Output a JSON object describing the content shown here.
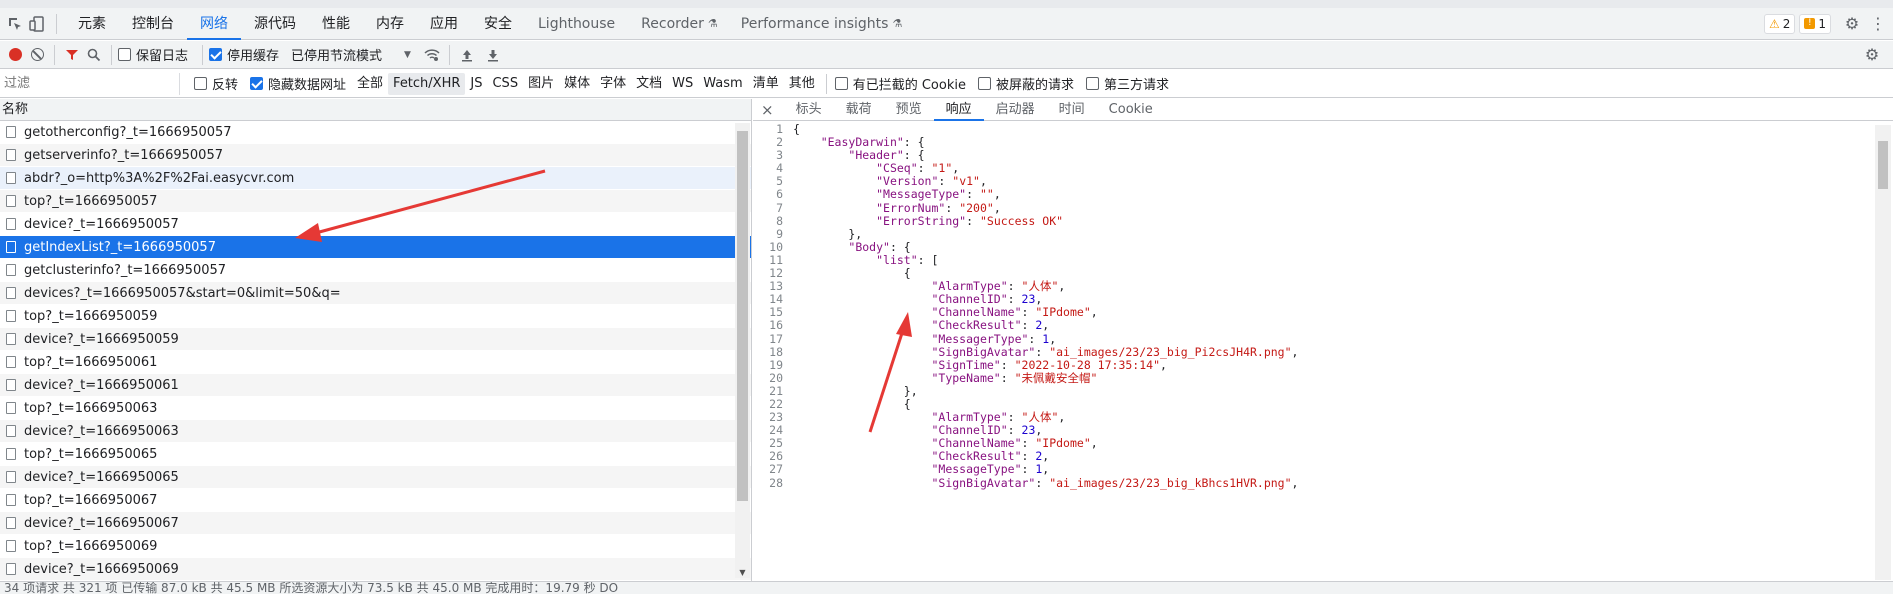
{
  "panel_tabs": [
    "元素",
    "控制台",
    "网络",
    "源代码",
    "性能",
    "内存",
    "应用",
    "安全",
    "Lighthouse",
    "Recorder",
    "Performance insights"
  ],
  "badges": {
    "warnings": "2",
    "issues": "1"
  },
  "toolbar": {
    "preserve_log": "保留日志",
    "disable_cache": "停用缓存",
    "throttle": "已停用节流模式",
    "throttle_caret": "▼"
  },
  "filter": {
    "placeholder": "过滤",
    "invert": "反转",
    "hide_data_urls": "隐藏数据网址",
    "types": [
      "全部",
      "Fetch/XHR",
      "JS",
      "CSS",
      "图片",
      "媒体",
      "字体",
      "文档",
      "WS",
      "Wasm",
      "清单",
      "其他"
    ],
    "blocked_cookies": "有已拦截的 Cookie",
    "blocked_requests": "被屏蔽的请求",
    "third_party": "第三方请求"
  },
  "list": {
    "header": "名称",
    "rows": [
      "getotherconfig?_t=1666950057",
      "getserverinfo?_t=1666950057",
      "abdr?_o=http%3A%2F%2Fai.easycvr.com",
      "top?_t=1666950057",
      "device?_t=1666950057",
      "getIndexList?_t=1666950057",
      "getclusterinfo?_t=1666950057",
      "devices?_t=1666950057&start=0&limit=50&q=",
      "top?_t=1666950059",
      "device?_t=1666950059",
      "top?_t=1666950061",
      "device?_t=1666950061",
      "top?_t=1666950063",
      "device?_t=1666950063",
      "top?_t=1666950065",
      "device?_t=1666950065",
      "top?_t=1666950067",
      "device?_t=1666950067",
      "top?_t=1666950069",
      "device?_t=1666950069"
    ]
  },
  "detail": {
    "close": "×",
    "tabs": [
      "标头",
      "载荷",
      "预览",
      "响应",
      "启动器",
      "时间",
      "Cookie"
    ]
  },
  "code_lines": [
    [
      {
        "t": "p",
        "v": "{"
      }
    ],
    [
      {
        "t": "p",
        "v": "    "
      },
      {
        "t": "k",
        "v": "\"EasyDarwin\""
      },
      {
        "t": "p",
        "v": ": {"
      }
    ],
    [
      {
        "t": "p",
        "v": "        "
      },
      {
        "t": "k",
        "v": "\"Header\""
      },
      {
        "t": "p",
        "v": ": {"
      }
    ],
    [
      {
        "t": "p",
        "v": "            "
      },
      {
        "t": "k",
        "v": "\"CSeq\""
      },
      {
        "t": "p",
        "v": ": "
      },
      {
        "t": "s",
        "v": "\"1\""
      },
      {
        "t": "p",
        "v": ","
      }
    ],
    [
      {
        "t": "p",
        "v": "            "
      },
      {
        "t": "k",
        "v": "\"Version\""
      },
      {
        "t": "p",
        "v": ": "
      },
      {
        "t": "s",
        "v": "\"v1\""
      },
      {
        "t": "p",
        "v": ","
      }
    ],
    [
      {
        "t": "p",
        "v": "            "
      },
      {
        "t": "k",
        "v": "\"MessageType\""
      },
      {
        "t": "p",
        "v": ": "
      },
      {
        "t": "s",
        "v": "\"\""
      },
      {
        "t": "p",
        "v": ","
      }
    ],
    [
      {
        "t": "p",
        "v": "            "
      },
      {
        "t": "k",
        "v": "\"ErrorNum\""
      },
      {
        "t": "p",
        "v": ": "
      },
      {
        "t": "s",
        "v": "\"200\""
      },
      {
        "t": "p",
        "v": ","
      }
    ],
    [
      {
        "t": "p",
        "v": "            "
      },
      {
        "t": "k",
        "v": "\"ErrorString\""
      },
      {
        "t": "p",
        "v": ": "
      },
      {
        "t": "s",
        "v": "\"Success OK\""
      }
    ],
    [
      {
        "t": "p",
        "v": "        },"
      }
    ],
    [
      {
        "t": "p",
        "v": "        "
      },
      {
        "t": "k",
        "v": "\"Body\""
      },
      {
        "t": "p",
        "v": ": {"
      }
    ],
    [
      {
        "t": "p",
        "v": "            "
      },
      {
        "t": "k",
        "v": "\"list\""
      },
      {
        "t": "p",
        "v": ": ["
      }
    ],
    [
      {
        "t": "p",
        "v": "                {"
      }
    ],
    [
      {
        "t": "p",
        "v": "                    "
      },
      {
        "t": "k",
        "v": "\"AlarmType\""
      },
      {
        "t": "p",
        "v": ": "
      },
      {
        "t": "s",
        "v": "\"人体\""
      },
      {
        "t": "p",
        "v": ","
      }
    ],
    [
      {
        "t": "p",
        "v": "                    "
      },
      {
        "t": "k",
        "v": "\"ChannelID\""
      },
      {
        "t": "p",
        "v": ": "
      },
      {
        "t": "n",
        "v": "23"
      },
      {
        "t": "p",
        "v": ","
      }
    ],
    [
      {
        "t": "p",
        "v": "                    "
      },
      {
        "t": "k",
        "v": "\"ChannelName\""
      },
      {
        "t": "p",
        "v": ": "
      },
      {
        "t": "s",
        "v": "\"IPdome\""
      },
      {
        "t": "p",
        "v": ","
      }
    ],
    [
      {
        "t": "p",
        "v": "                    "
      },
      {
        "t": "k",
        "v": "\"CheckResult\""
      },
      {
        "t": "p",
        "v": ": "
      },
      {
        "t": "n",
        "v": "2"
      },
      {
        "t": "p",
        "v": ","
      }
    ],
    [
      {
        "t": "p",
        "v": "                    "
      },
      {
        "t": "k",
        "v": "\"MessagerType\""
      },
      {
        "t": "p",
        "v": ": "
      },
      {
        "t": "n",
        "v": "1"
      },
      {
        "t": "p",
        "v": ","
      }
    ],
    [
      {
        "t": "p",
        "v": "                    "
      },
      {
        "t": "k",
        "v": "\"SignBigAvatar\""
      },
      {
        "t": "p",
        "v": ": "
      },
      {
        "t": "s",
        "v": "\"ai_images/23/23_big_Pi2csJH4R.png\""
      },
      {
        "t": "p",
        "v": ","
      }
    ],
    [
      {
        "t": "p",
        "v": "                    "
      },
      {
        "t": "k",
        "v": "\"SignTime\""
      },
      {
        "t": "p",
        "v": ": "
      },
      {
        "t": "s",
        "v": "\"2022-10-28 17:35:14\""
      },
      {
        "t": "p",
        "v": ","
      }
    ],
    [
      {
        "t": "p",
        "v": "                    "
      },
      {
        "t": "k",
        "v": "\"TypeName\""
      },
      {
        "t": "p",
        "v": ": "
      },
      {
        "t": "s",
        "v": "\"未佩戴安全帽\""
      }
    ],
    [
      {
        "t": "p",
        "v": "                },"
      }
    ],
    [
      {
        "t": "p",
        "v": "                {"
      }
    ],
    [
      {
        "t": "p",
        "v": "                    "
      },
      {
        "t": "k",
        "v": "\"AlarmType\""
      },
      {
        "t": "p",
        "v": ": "
      },
      {
        "t": "s",
        "v": "\"人体\""
      },
      {
        "t": "p",
        "v": ","
      }
    ],
    [
      {
        "t": "p",
        "v": "                    "
      },
      {
        "t": "k",
        "v": "\"ChannelID\""
      },
      {
        "t": "p",
        "v": ": "
      },
      {
        "t": "n",
        "v": "23"
      },
      {
        "t": "p",
        "v": ","
      }
    ],
    [
      {
        "t": "p",
        "v": "                    "
      },
      {
        "t": "k",
        "v": "\"ChannelName\""
      },
      {
        "t": "p",
        "v": ": "
      },
      {
        "t": "s",
        "v": "\"IPdome\""
      },
      {
        "t": "p",
        "v": ","
      }
    ],
    [
      {
        "t": "p",
        "v": "                    "
      },
      {
        "t": "k",
        "v": "\"CheckResult\""
      },
      {
        "t": "p",
        "v": ": "
      },
      {
        "t": "n",
        "v": "2"
      },
      {
        "t": "p",
        "v": ","
      }
    ],
    [
      {
        "t": "p",
        "v": "                    "
      },
      {
        "t": "k",
        "v": "\"MessageType\""
      },
      {
        "t": "p",
        "v": ": "
      },
      {
        "t": "n",
        "v": "1"
      },
      {
        "t": "p",
        "v": ","
      }
    ],
    [
      {
        "t": "p",
        "v": "                    "
      },
      {
        "t": "k",
        "v": "\"SignBigAvatar\""
      },
      {
        "t": "p",
        "v": ": "
      },
      {
        "t": "s",
        "v": "\"ai_images/23/23_big_kBhcs1HVR.png\""
      },
      {
        "t": "p",
        "v": ","
      }
    ]
  ],
  "status_bar": "34 项请求  共 321 项  已传输 87.0 kB  共 45.5 MB  所选资源大小为 73.5 kB  共 45.0 MB  完成用时：19.79 秒  DO",
  "colors": {
    "accent": "#1a73e8",
    "record": "#d93025",
    "annotation_arrow": "#e53935"
  }
}
